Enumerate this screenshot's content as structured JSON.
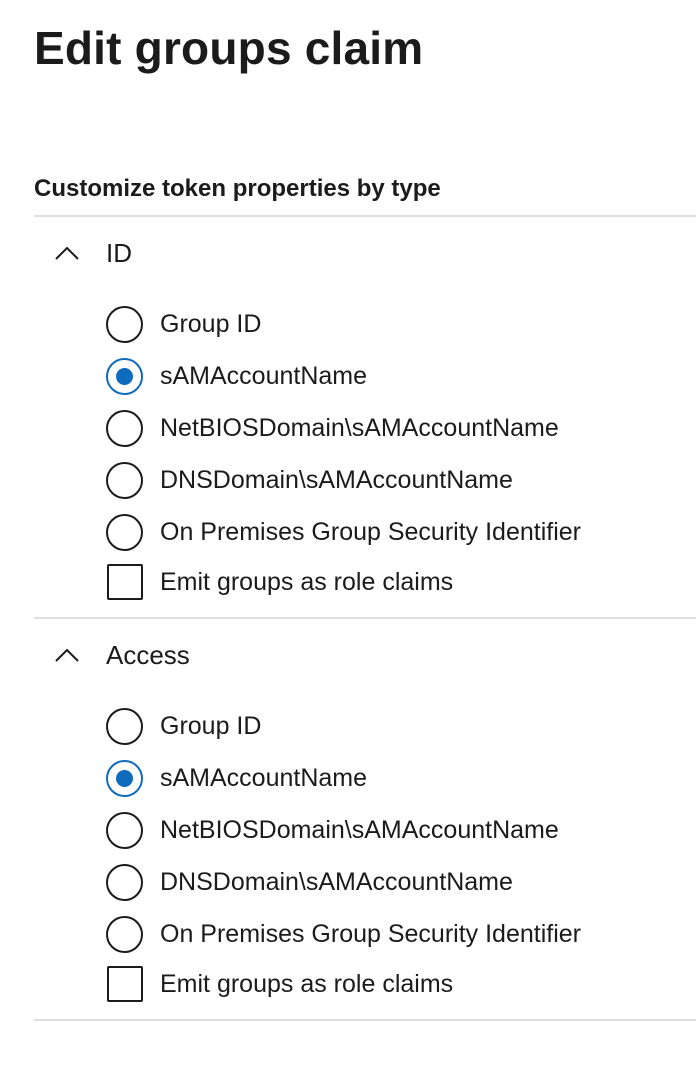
{
  "title": "Edit groups claim",
  "section_heading": "Customize token properties by type",
  "icons": {
    "collapse": "chevron-up-icon"
  },
  "colors": {
    "accent": "#0f6cbd",
    "divider": "#e1dfdd",
    "text": "#1b1b1b"
  },
  "groups": [
    {
      "title": "ID",
      "expanded": true,
      "selected": "sAMAccountName",
      "options": [
        {
          "label": "Group ID",
          "checked": false
        },
        {
          "label": "sAMAccountName",
          "checked": true
        },
        {
          "label": "NetBIOSDomain\\sAMAccountName",
          "checked": false
        },
        {
          "label": "DNSDomain\\sAMAccountName",
          "checked": false
        },
        {
          "label": "On Premises Group Security Identifier",
          "checked": false
        }
      ],
      "checkbox": {
        "label": "Emit groups as role claims",
        "checked": false
      }
    },
    {
      "title": "Access",
      "expanded": true,
      "selected": "sAMAccountName",
      "options": [
        {
          "label": "Group ID",
          "checked": false
        },
        {
          "label": "sAMAccountName",
          "checked": true
        },
        {
          "label": "NetBIOSDomain\\sAMAccountName",
          "checked": false
        },
        {
          "label": "DNSDomain\\sAMAccountName",
          "checked": false
        },
        {
          "label": "On Premises Group Security Identifier",
          "checked": false
        }
      ],
      "checkbox": {
        "label": "Emit groups as role claims",
        "checked": false
      }
    }
  ]
}
